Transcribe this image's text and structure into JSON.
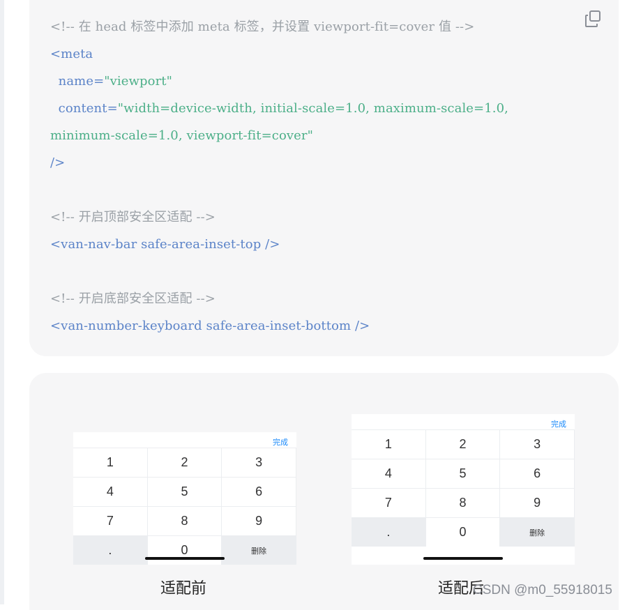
{
  "code": {
    "lines": [
      {
        "parts": [
          {
            "t": "<!-- 在 head 标签中添加 meta 标签，并设置 viewport-fit=cover 值 -->",
            "c": "c-comment"
          }
        ]
      },
      {
        "parts": [
          {
            "t": "<meta",
            "c": "c-tag"
          }
        ]
      },
      {
        "parts": [
          {
            "t": "  name=",
            "c": "c-attr"
          },
          {
            "t": "\"viewport\"",
            "c": "c-str"
          }
        ]
      },
      {
        "parts": [
          {
            "t": "  content=",
            "c": "c-attr"
          },
          {
            "t": "\"width=device-width, initial-scale=1.0, maximum-scale=1.0,",
            "c": "c-str"
          }
        ]
      },
      {
        "parts": [
          {
            "t": "minimum-scale=1.0, viewport-fit=cover\"",
            "c": "c-str"
          }
        ]
      },
      {
        "parts": [
          {
            "t": "/>",
            "c": "c-tag"
          }
        ]
      },
      {
        "parts": []
      },
      {
        "parts": [
          {
            "t": "<!-- 开启顶部安全区适配 -->",
            "c": "c-comment"
          }
        ]
      },
      {
        "parts": [
          {
            "t": "<van-nav-bar safe-area-inset-top />",
            "c": "c-tag"
          }
        ]
      },
      {
        "parts": []
      },
      {
        "parts": [
          {
            "t": "<!-- 开启底部安全区适配 -->",
            "c": "c-comment"
          }
        ]
      },
      {
        "parts": [
          {
            "t": "<van-number-keyboard safe-area-inset-bottom />",
            "c": "c-tag"
          }
        ]
      }
    ],
    "copy_icon": "copy-icon"
  },
  "keyboards": {
    "done_label": "完成",
    "delete_label": "删除",
    "keys": [
      "1",
      "2",
      "3",
      "4",
      "5",
      "6",
      "7",
      "8",
      "9",
      ".",
      "0"
    ],
    "before_caption": "适配前",
    "after_caption": "适配后"
  },
  "watermark": "CSDN @m0_55918015"
}
